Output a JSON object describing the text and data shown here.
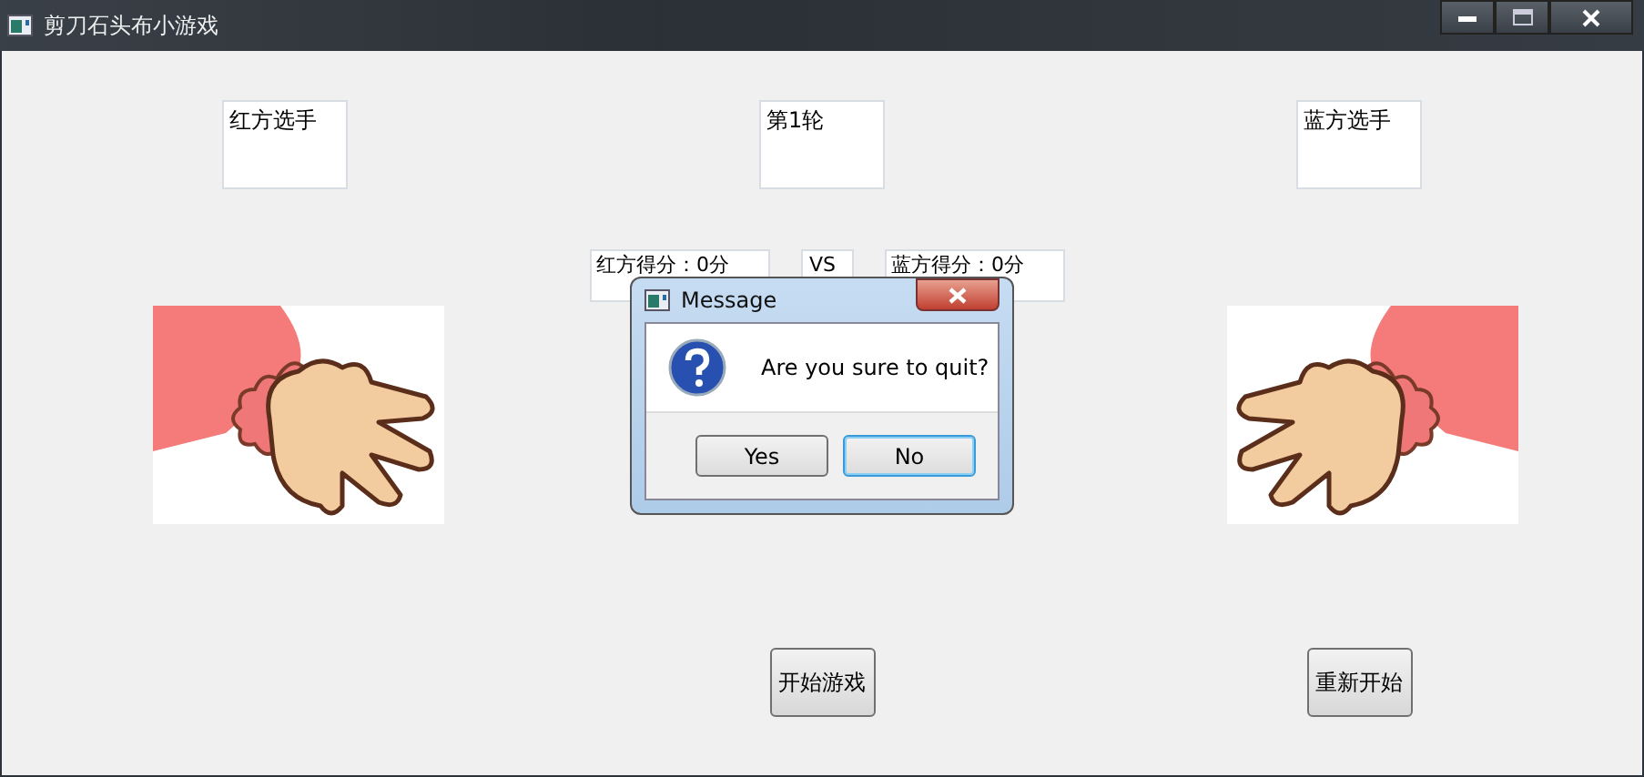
{
  "window": {
    "title": "剪刀石头布小游戏"
  },
  "labels": [
    "红方选手",
    "第1轮",
    "蓝方选手"
  ],
  "scores": {
    "red": "红方得分：0分",
    "vs": "VS",
    "blue": "蓝方得分：0分"
  },
  "buttons": [
    "开始游戏",
    "重新开始"
  ],
  "dialog": {
    "title": "Message",
    "message": "Are you sure to quit?",
    "buttons": [
      {
        "label": "Yes",
        "selected": false
      },
      {
        "label": "No",
        "selected": true
      }
    ]
  }
}
